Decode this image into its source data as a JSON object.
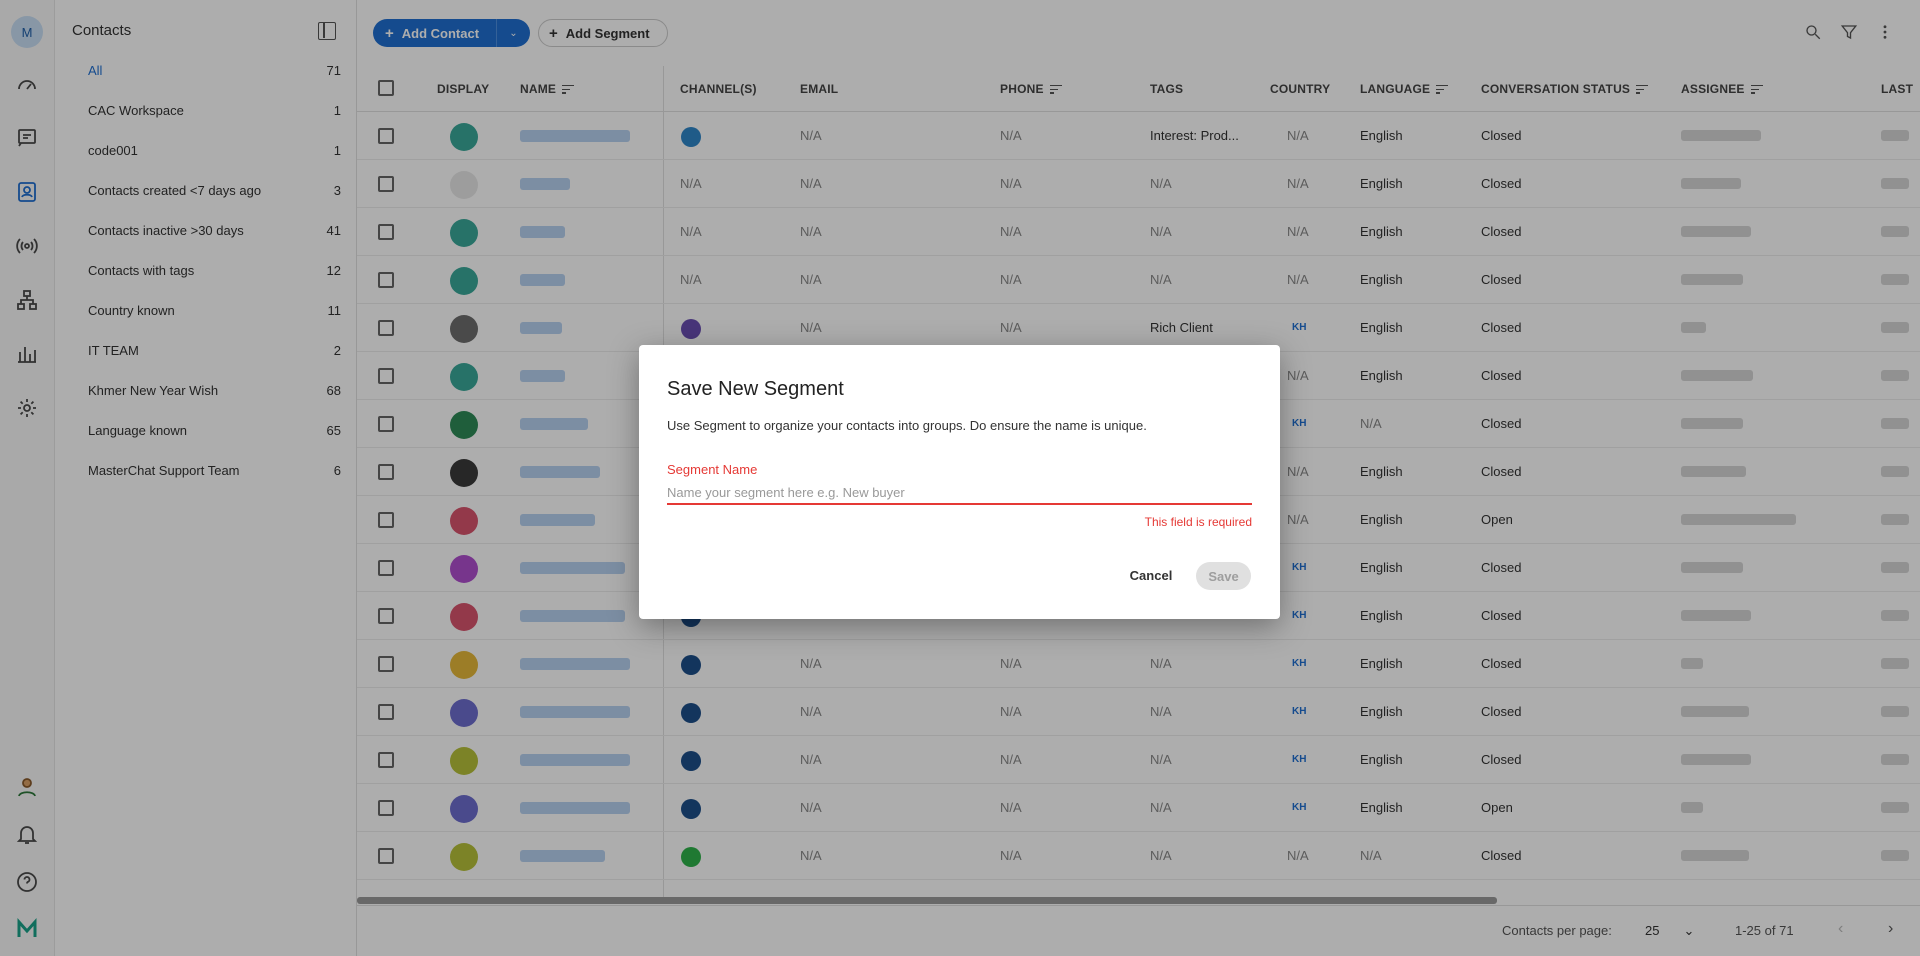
{
  "rail": {
    "avatar_letter": "M",
    "icons": [
      "dashboard-icon",
      "messages-icon",
      "contacts-icon",
      "broadcast-icon",
      "workflow-icon",
      "reports-icon",
      "settings-icon",
      "user-avatar-icon",
      "bell-icon",
      "help-icon",
      "brand-logo-icon"
    ]
  },
  "sidebar": {
    "title": "Contacts",
    "segments": [
      {
        "label": "All",
        "count": "71"
      },
      {
        "label": "CAC Workspace",
        "count": "1"
      },
      {
        "label": "code001",
        "count": "1"
      },
      {
        "label": "Contacts created <7 days ago",
        "count": "3"
      },
      {
        "label": "Contacts inactive >30 days",
        "count": "41"
      },
      {
        "label": "Contacts with tags",
        "count": "12"
      },
      {
        "label": "Country known",
        "count": "11"
      },
      {
        "label": "IT TEAM",
        "count": "2"
      },
      {
        "label": "Khmer New Year Wish",
        "count": "68"
      },
      {
        "label": "Language known",
        "count": "65"
      },
      {
        "label": "MasterChat Support Team",
        "count": "6"
      }
    ]
  },
  "toolbar": {
    "add_contact": "Add Contact",
    "add_segment": "Add Segment"
  },
  "table": {
    "columns": [
      "DISPLAY",
      "NAME",
      "CHANNEL(S)",
      "EMAIL",
      "PHONE",
      "TAGS",
      "COUNTRY",
      "LANGUAGE",
      "CONVERSATION STATUS",
      "ASSIGNEE",
      "LAST"
    ],
    "rows": [
      {
        "avatar": "#3aa89a",
        "channel": "#2f86c9",
        "email": "N/A",
        "phone": "N/A",
        "tags": "Interest: Prod...",
        "country": "N/A",
        "language": "English",
        "status": "Closed"
      },
      {
        "avatar": "#e8e8e8",
        "channel": "",
        "channel_text": "N/A",
        "email": "N/A",
        "phone": "N/A",
        "tags": "N/A",
        "country": "N/A",
        "language": "English",
        "status": "Closed"
      },
      {
        "avatar": "#3aa89a",
        "channel": "",
        "channel_text": "N/A",
        "email": "N/A",
        "phone": "N/A",
        "tags": "N/A",
        "country": "N/A",
        "language": "English",
        "status": "Closed"
      },
      {
        "avatar": "#3aa89a",
        "channel": "",
        "channel_text": "N/A",
        "email": "N/A",
        "phone": "N/A",
        "tags": "N/A",
        "country": "N/A",
        "language": "English",
        "status": "Closed"
      },
      {
        "avatar": "#6d6d6d",
        "channel": "#6a4fb3",
        "email": "N/A",
        "phone": "N/A",
        "tags": "Rich Client",
        "country": "KH",
        "language": "English",
        "status": "Closed"
      },
      {
        "avatar": "#3aa89a",
        "channel": "",
        "channel_text": "",
        "email": "",
        "phone": "",
        "tags": "",
        "country": "N/A",
        "language": "English",
        "status": "Closed"
      },
      {
        "avatar": "#2e8b57",
        "channel": "",
        "channel_text": "",
        "email": "",
        "phone": "",
        "tags": "",
        "country": "KH",
        "language": "N/A",
        "status": "Closed"
      },
      {
        "avatar": "#3a3a3a",
        "channel": "",
        "channel_text": "",
        "email": "",
        "phone": "",
        "tags": "",
        "country": "N/A",
        "language": "English",
        "status": "Closed"
      },
      {
        "avatar": "#d9546e",
        "channel": "",
        "channel_text": "",
        "email": "",
        "phone": "",
        "tags": "",
        "country": "N/A",
        "language": "English",
        "status": "Open"
      },
      {
        "avatar": "#b04fcf",
        "channel": "",
        "channel_text": "",
        "email": "",
        "phone": "",
        "tags": "",
        "country": "KH",
        "language": "English",
        "status": "Closed"
      },
      {
        "avatar": "#d9546e",
        "channel": "#1c4f8a",
        "email": "",
        "phone": "",
        "tags": "",
        "country": "KH",
        "language": "English",
        "status": "Closed"
      },
      {
        "avatar": "#e6b83a",
        "channel": "#1c4f8a",
        "email": "N/A",
        "phone": "N/A",
        "tags": "N/A",
        "country": "KH",
        "language": "English",
        "status": "Closed"
      },
      {
        "avatar": "#6e6ecf",
        "channel": "#1c4f8a",
        "email": "N/A",
        "phone": "N/A",
        "tags": "N/A",
        "country": "KH",
        "language": "English",
        "status": "Closed"
      },
      {
        "avatar": "#b7c23a",
        "channel": "#1c4f8a",
        "email": "N/A",
        "phone": "N/A",
        "tags": "N/A",
        "country": "KH",
        "language": "English",
        "status": "Closed"
      },
      {
        "avatar": "#6e6ecf",
        "channel": "#1c4f8a",
        "email": "N/A",
        "phone": "N/A",
        "tags": "N/A",
        "country": "KH",
        "language": "English",
        "status": "Open"
      },
      {
        "avatar": "#b7c23a",
        "channel": "#2fb34a",
        "email": "N/A",
        "phone": "N/A",
        "tags": "N/A",
        "country": "N/A",
        "language": "N/A",
        "status": "Closed"
      }
    ]
  },
  "pager": {
    "per_page_label": "Contacts per page:",
    "per_page_value": "25",
    "range": "1-25 of 71"
  },
  "dialog": {
    "title": "Save New Segment",
    "description": "Use Segment to organize your contacts into groups. Do ensure the name is unique.",
    "field_label": "Segment Name",
    "placeholder": "Name your segment here e.g. New buyer",
    "error": "This field is required",
    "cancel": "Cancel",
    "save": "Save"
  }
}
